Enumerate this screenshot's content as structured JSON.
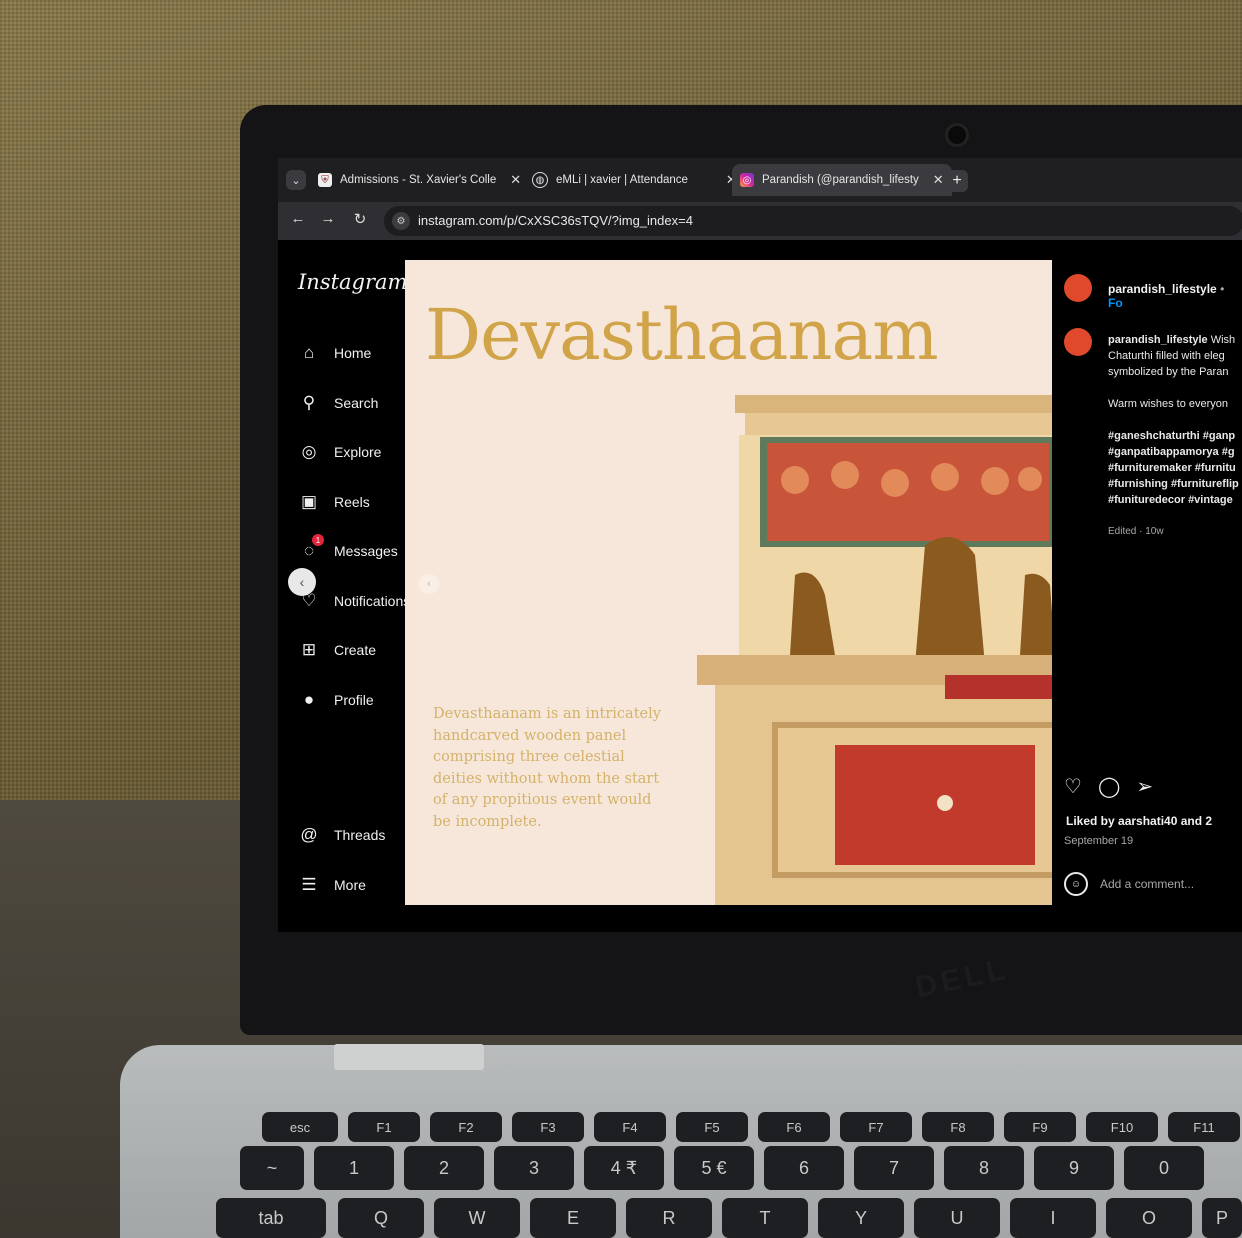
{
  "browser": {
    "tabs": [
      {
        "title": "Admissions - St. Xavier's Colle",
        "close": "✕"
      },
      {
        "title": "eMLi | xavier | Attendance",
        "close": "✕"
      },
      {
        "title": "Parandish (@parandish_lifesty",
        "close": "✕",
        "active": true
      }
    ],
    "new_tab": "+",
    "url": "instagram.com/p/CxXSC36sTQV/?img_index=4"
  },
  "instagram": {
    "logo": "Instagram",
    "nav": [
      {
        "label": "Home",
        "icon": "home-icon"
      },
      {
        "label": "Search",
        "icon": "search-icon"
      },
      {
        "label": "Explore",
        "icon": "compass-icon"
      },
      {
        "label": "Reels",
        "icon": "reels-icon"
      },
      {
        "label": "Messages",
        "icon": "messenger-icon",
        "badge": "1"
      },
      {
        "label": "Notifications",
        "icon": "heart-icon"
      },
      {
        "label": "Create",
        "icon": "plus-square-icon"
      },
      {
        "label": "Profile",
        "icon": "avatar-icon"
      },
      {
        "label": "Threads",
        "icon": "threads-icon"
      },
      {
        "label": "More",
        "icon": "menu-icon"
      }
    ]
  },
  "post": {
    "title": "Devasthaanam",
    "body": "Devasthaanam is an intricately handcarved wooden panel comprising three celestial deities without whom the start of any propitious event would be incomplete."
  },
  "side_panel": {
    "header_username": "parandish_lifestyle",
    "follow_label": "Fo",
    "caption_username": "parandish_lifestyle",
    "caption_line1": "Wish",
    "caption_line2": "Chaturthi filled with eleg",
    "caption_line3": "symbolized by the Paran",
    "caption_para2": "Warm wishes to everyon",
    "hashtags": "#ganeshchaturthi #ganp #ganpatibappamorya #g #furnituremaker #furnitu #furnishing #furnitureflip #funituredecor #vintage",
    "edited": "Edited · 10w",
    "likes": "Liked by aarshati40 and 2",
    "date": "September 19",
    "add_comment": "Add a comment..."
  },
  "keyboard": {
    "fn_row": [
      "esc",
      "F1",
      "F2",
      "F3",
      "F4",
      "F5",
      "F6",
      "F7",
      "F8",
      "F9",
      "F10",
      "F11"
    ],
    "num_row": [
      "~",
      "1",
      "2",
      "3",
      "4 ₹",
      "5 €",
      "6",
      "7",
      "8",
      "9",
      "0"
    ],
    "qwerty_row": [
      "tab",
      "Q",
      "W",
      "E",
      "R",
      "T",
      "Y",
      "U",
      "I",
      "O",
      "P"
    ]
  },
  "laptop_brand": "DELL"
}
